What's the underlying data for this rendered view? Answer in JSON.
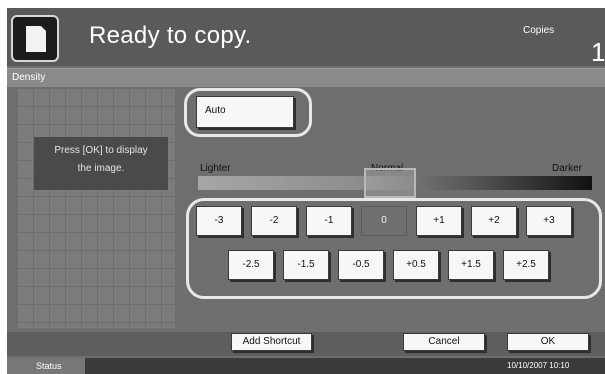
{
  "header": {
    "title": "Ready to copy.",
    "copies_label": "Copies",
    "copies_count": "1"
  },
  "section": {
    "label": "Density"
  },
  "preview": {
    "line1": "Press [OK] to display",
    "line2": "the image."
  },
  "auto": {
    "label": "Auto"
  },
  "scale": {
    "lighter": "Lighter",
    "normal": "Normal",
    "darker": "Darker",
    "level": 0
  },
  "steps_row1": [
    "-3",
    "-2",
    "-1",
    "0",
    "+1",
    "+2",
    "+3"
  ],
  "steps_row2": [
    "-2.5",
    "-1.5",
    "-0.5",
    "+0.5",
    "+1.5",
    "+2.5"
  ],
  "selected_step": "0",
  "footer": {
    "add_shortcut": "Add Shortcut",
    "cancel": "Cancel",
    "ok": "OK"
  },
  "status": {
    "label": "Status",
    "datetime": "10/10/2007   10:10"
  }
}
